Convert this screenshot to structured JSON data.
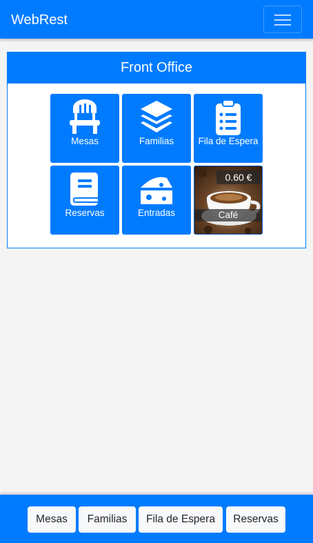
{
  "navbar": {
    "brand": "WebRest",
    "menu_icon": "hamburger-menu-icon"
  },
  "card": {
    "title": "Front Office",
    "tiles": [
      {
        "label": "Mesas",
        "icon": "chair-icon"
      },
      {
        "label": "Familias",
        "icon": "layers-icon"
      },
      {
        "label": "Fila de Espera",
        "icon": "clipboard-list-icon"
      },
      {
        "label": "Reservas",
        "icon": "book-icon"
      },
      {
        "label": "Entradas",
        "icon": "cheese-icon"
      }
    ],
    "product": {
      "name": "Café",
      "price": "0.60 €",
      "image": "coffee-cup-image"
    }
  },
  "footer": {
    "buttons": [
      "Mesas",
      "Familias",
      "Fila de Espera",
      "Reservas"
    ]
  },
  "colors": {
    "primary": "#007bff",
    "background": "#f4f4f4",
    "button_light": "#f8f9fa"
  }
}
